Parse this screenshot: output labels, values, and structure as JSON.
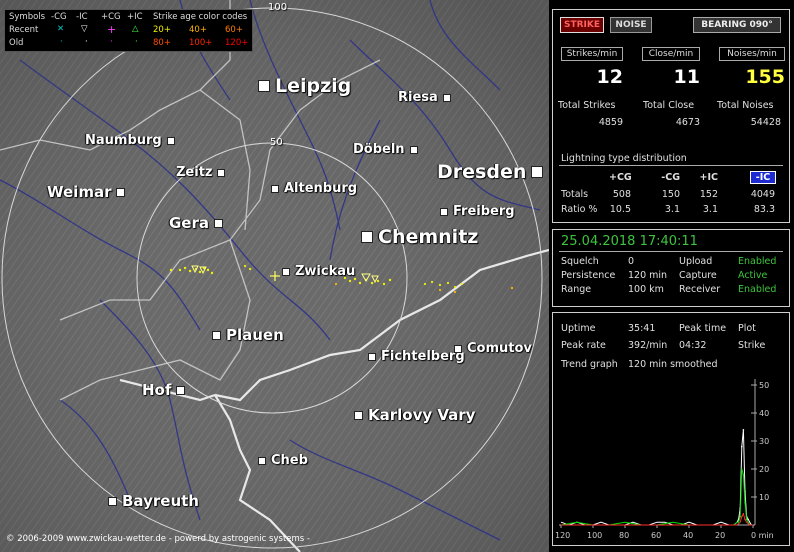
{
  "legend": {
    "symbols_label": "Symbols",
    "neg_cg": "-CG",
    "neg_ic": "-IC",
    "pos_cg": "+CG",
    "pos_ic": "+IC",
    "age_title": "Strike age color codes",
    "recent_label": "Recent",
    "old_label": "Old",
    "recent_cg_sym": "✕",
    "recent_ic_sym": "▽",
    "recent_pcg_sym": "+",
    "recent_pic_sym": "△",
    "old_sym": "·",
    "age_1": "20+",
    "age_2": "40+",
    "age_3": "60+",
    "age_4": "80+",
    "age_5": "100+",
    "age_6": "120+",
    "colors": {
      "age_1": "#f0f000",
      "age_2": "#ffb400",
      "age_3": "#ff7f00",
      "age_4": "#ff5000",
      "age_5": "#ff2800",
      "age_6": "#ff0000"
    }
  },
  "map": {
    "ring_100": "100",
    "ring_50": "50",
    "cities": {
      "leipzig": "Leipzig",
      "riesa": "Riesa",
      "naumburg": "Naumburg",
      "dobeln": "Döbeln",
      "dresden": "Dresden",
      "zeitz": "Zeitz",
      "altenburg": "Altenburg",
      "weimar": "Weimar",
      "freiberg": "Freiberg",
      "gera": "Gera",
      "chemnitz": "Chemnitz",
      "zwickau": "Zwickau",
      "plauen": "Plauen",
      "fichtelberg": "Fichtelberg",
      "comutov": "Comutov",
      "hof": "Hof",
      "karlovy_vary": "Karlovy Vary",
      "cheb": "Cheb",
      "bayreuth": "Bayreuth"
    },
    "copyright": "© 2006-2009 www.zwickau-wetter.de - powerd by astrogenic systems -"
  },
  "top_buttons": {
    "strike": "STRIKE",
    "noise": "NOISE",
    "bearing": "BEARING 090°"
  },
  "counters": {
    "strikes_min_label": "Strikes/min",
    "strikes_min": "12",
    "close_min_label": "Close/min",
    "close_min": "11",
    "noises_min_label": "Noises/min",
    "noises_min": "155",
    "total_strikes_label": "Total Strikes",
    "total_strikes": "4859",
    "total_close_label": "Total Close",
    "total_close": "4673",
    "total_noises_label": "Total Noises",
    "total_noises": "54428"
  },
  "distribution": {
    "title": "Lightning type distribution",
    "columns": [
      "+CG",
      "-CG",
      "+IC",
      "-IC"
    ],
    "totals_label": "Totals",
    "totals": [
      "508",
      "150",
      "152",
      "4049"
    ],
    "ratio_label": "Ratio %",
    "ratios": [
      "10.5",
      "3.1",
      "3.1",
      "83.3"
    ]
  },
  "status": {
    "datetime": "25.04.2018 17:40:11",
    "squelch_label": "Squelch",
    "squelch": "0",
    "persistence_label": "Persistence",
    "persistence": "120 min",
    "range_label": "Range",
    "range": "100 km",
    "upload_label": "Upload",
    "upload": "Enabled",
    "capture_label": "Capture",
    "capture": "Active",
    "receiver_label": "Receiver",
    "receiver": "Enabled"
  },
  "stats": {
    "uptime_label": "Uptime",
    "uptime": "35:41",
    "peak_time_label": "Peak time",
    "peak_time": "04:32",
    "plot_label": "Plot",
    "plot": "Strike",
    "peak_rate_label": "Peak rate",
    "peak_rate": "392/min",
    "trend_label": "Trend graph",
    "trend": "120 min smoothed"
  },
  "chart_data": {
    "type": "area",
    "x_ticks": [
      "120",
      "100",
      "80",
      "60",
      "40",
      "20",
      "0 min"
    ],
    "y_ticks": [
      "50",
      "40",
      "30",
      "20",
      "10"
    ],
    "ylim": [
      0,
      50
    ],
    "xlim": [
      120,
      0
    ],
    "series": [
      {
        "color": "#ffffff",
        "x": [
          120,
          115,
          110,
          105,
          100,
          95,
          90,
          85,
          80,
          75,
          70,
          65,
          60,
          55,
          50,
          45,
          40,
          35,
          30,
          25,
          20,
          15,
          12,
          10,
          9,
          8,
          7,
          6,
          5,
          4,
          3,
          2,
          1,
          0
        ],
        "values": [
          1,
          0,
          1,
          0,
          0,
          1,
          0,
          0,
          0,
          1,
          0,
          0,
          1,
          1,
          0,
          0,
          1,
          0,
          0,
          0,
          1,
          0,
          0,
          1,
          2,
          6,
          28,
          34,
          12,
          3,
          2,
          1,
          0,
          0
        ]
      },
      {
        "color": "#00dd00",
        "x": [
          120,
          110,
          100,
          90,
          80,
          70,
          60,
          50,
          40,
          30,
          20,
          12,
          10,
          9,
          8,
          7,
          6,
          5,
          4,
          3,
          2,
          1,
          0
        ],
        "values": [
          0,
          1,
          0,
          0,
          1,
          0,
          0,
          1,
          0,
          0,
          0,
          0,
          1,
          1,
          3,
          20,
          18,
          8,
          2,
          1,
          0,
          0,
          0
        ]
      },
      {
        "color": "#ff3030",
        "x": [
          120,
          100,
          80,
          60,
          40,
          20,
          10,
          8,
          7,
          6,
          5,
          4,
          2,
          0
        ],
        "values": [
          0,
          0,
          0,
          0,
          0,
          0,
          0,
          1,
          3,
          4,
          2,
          1,
          0,
          0
        ]
      }
    ]
  }
}
